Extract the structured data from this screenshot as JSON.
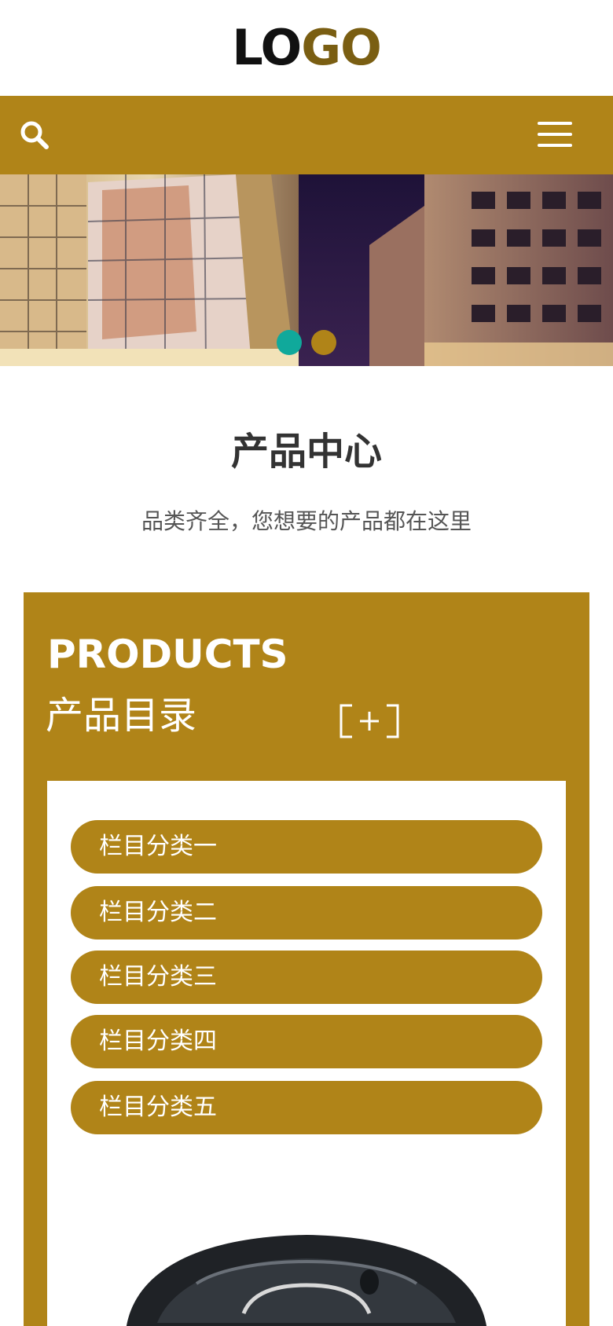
{
  "header": {
    "logo_part1": "LO",
    "logo_part2": "GO"
  },
  "navbar": {
    "search_icon": "search-icon",
    "menu_icon": "hamburger-menu-icon",
    "color": "#b08418"
  },
  "banner": {
    "slides_total": 2,
    "active_slide": 1,
    "dot_colors": [
      "#10a99b",
      "#b08418"
    ]
  },
  "section": {
    "title": "产品中心",
    "subtitle": "品类齐全，您想要的产品都在这里"
  },
  "products": {
    "heading_en": "PRODUCTS",
    "heading_cn": "产品目录",
    "expand_icon": "plus-bracket-icon",
    "categories": [
      {
        "label": "栏目分类一"
      },
      {
        "label": "栏目分类二"
      },
      {
        "label": "栏目分类三"
      },
      {
        "label": "栏目分类四"
      },
      {
        "label": "栏目分类五"
      }
    ]
  },
  "colors": {
    "accent": "#b08418",
    "teal": "#10a99b",
    "title_text": "#333333"
  }
}
